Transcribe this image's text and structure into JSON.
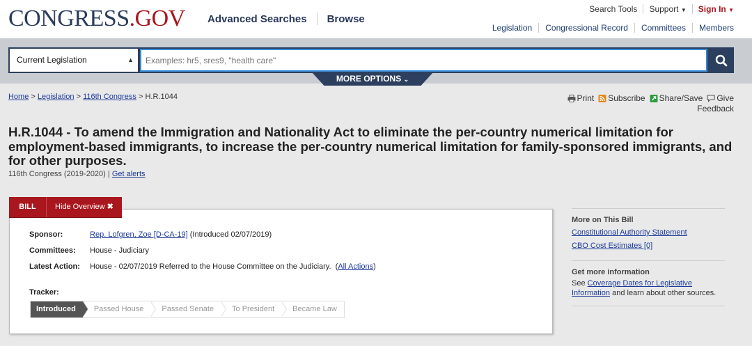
{
  "header": {
    "logo_main": "CONGRESS",
    "logo_dot": ".GOV",
    "nav": [
      "Advanced Searches",
      "Browse"
    ],
    "util": {
      "search_tools": "Search Tools",
      "support": "Support",
      "sign_in": "Sign In"
    },
    "secondary": [
      "Legislation",
      "Congressional Record",
      "Committees",
      "Members"
    ]
  },
  "search": {
    "scope": "Current Legislation",
    "placeholder": "Examples: hr5, sres9, \"health care\"",
    "more_options": "MORE OPTIONS"
  },
  "breadcrumb": {
    "home": "Home",
    "legislation": "Legislation",
    "congress": "116th Congress",
    "current": "H.R.1044",
    "sep": ">"
  },
  "tools": {
    "print": "Print",
    "subscribe": "Subscribe",
    "share": "Share/Save",
    "give": "Give",
    "feedback": "Feedback"
  },
  "bill": {
    "title": "H.R.1044 - To amend the Immigration and Nationality Act to eliminate the per-country numerical limitation for employment-based immigrants, to increase the per-country numerical limitation for family-sponsored immigrants, and for other purposes.",
    "congress": "116th Congress (2019-2020)",
    "sep": "|",
    "get_alerts": "Get alerts"
  },
  "tabs": {
    "bill": "BILL",
    "hide": "Hide Overview"
  },
  "overview": {
    "sponsor_label": "Sponsor:",
    "sponsor_link": "Rep. Lofgren, Zoe [D-CA-19]",
    "sponsor_extra": "(Introduced 02/07/2019)",
    "committees_label": "Committees:",
    "committees_value": "House - Judiciary",
    "action_label": "Latest Action:",
    "action_value": "House - 02/07/2019 Referred to the House Committee on the Judiciary.",
    "action_link": "All Actions",
    "tracker_label": "Tracker:",
    "tracker_steps": [
      "Introduced",
      "Passed House",
      "Passed Senate",
      "To President",
      "Became Law"
    ]
  },
  "sidebar": {
    "more_heading": "More on This Bill",
    "link1": "Constitutional Authority Statement",
    "link2": "CBO Cost Estimates [0]",
    "info_heading": "Get more information",
    "see": "See",
    "info_link": "Coverage Dates for Legislative Information",
    "info_tail": "and learn about other sources."
  },
  "colors": {
    "brand_navy": "#2d3f5e",
    "brand_red": "#a9161d",
    "link": "#1d3b9a"
  }
}
